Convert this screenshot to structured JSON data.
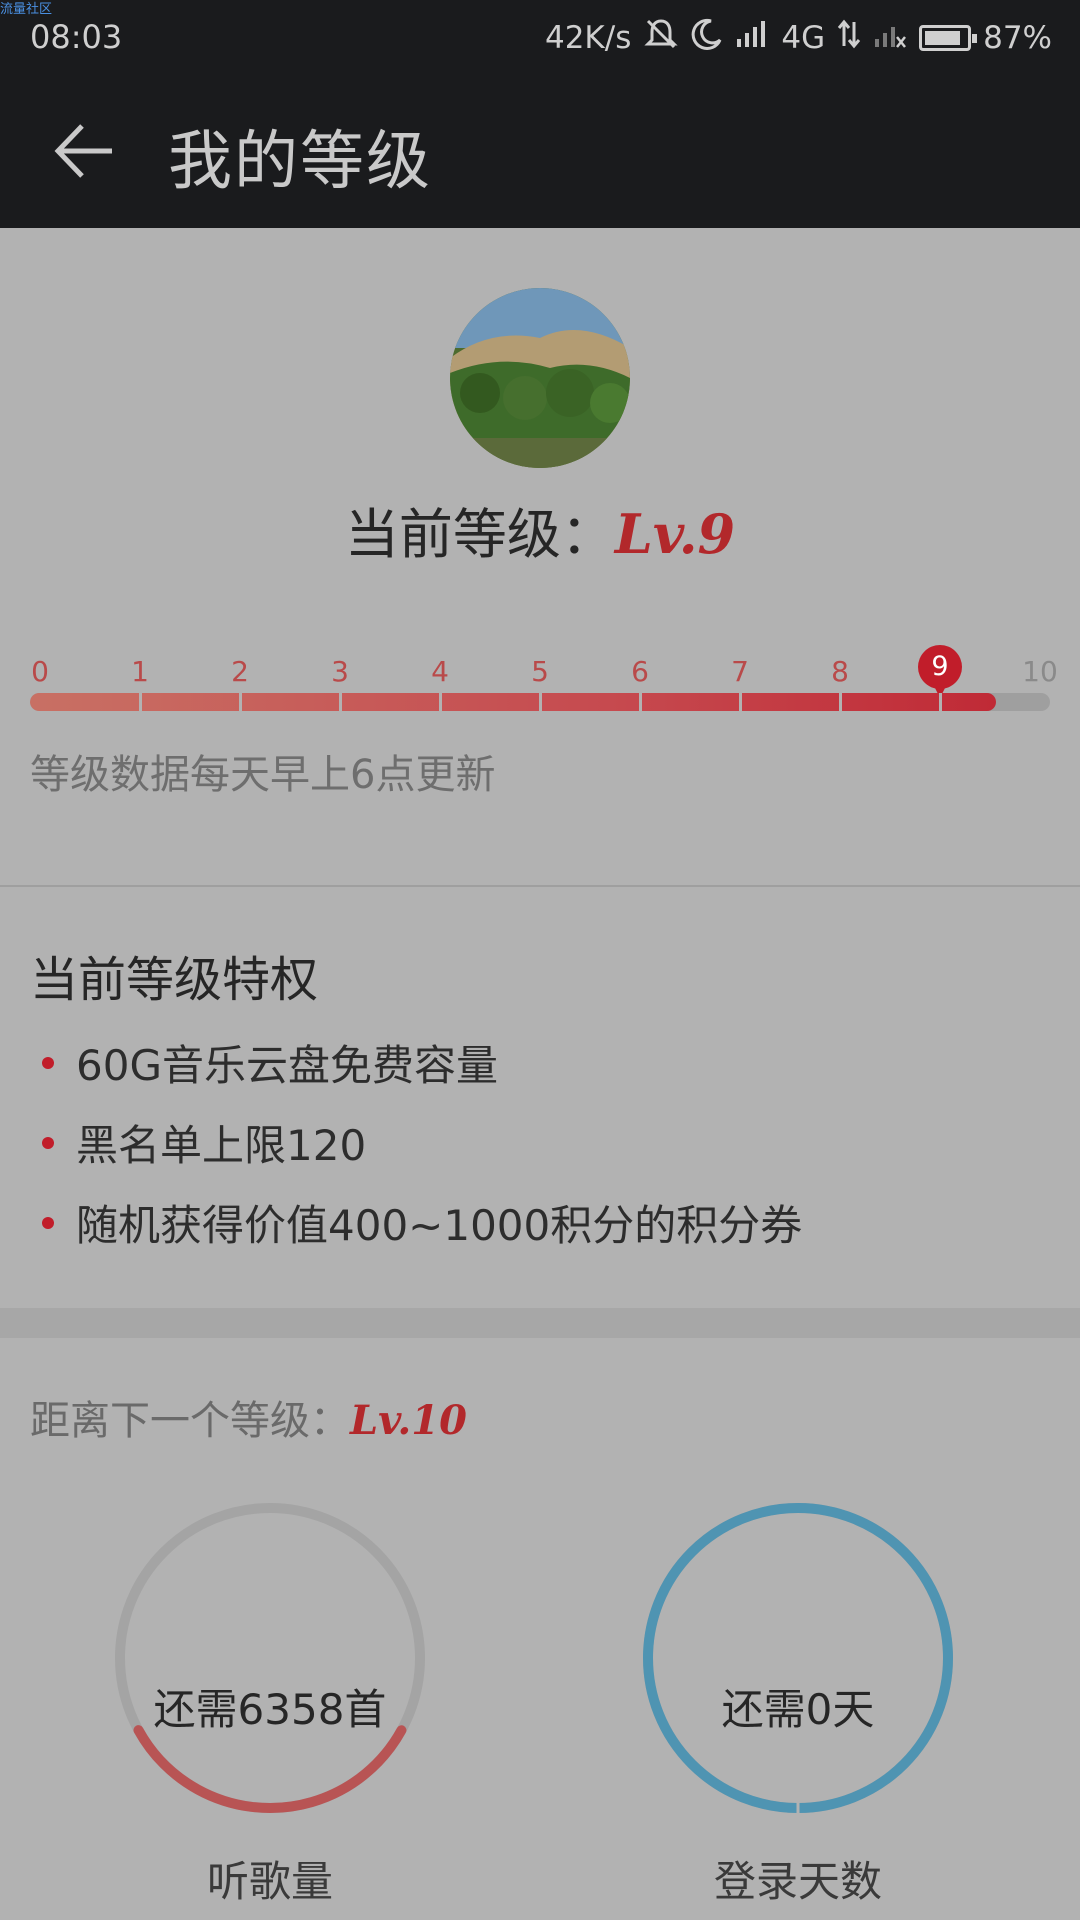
{
  "status_bar": {
    "watermark": "流量社区",
    "time": "08:03",
    "net_speed": "42K/s",
    "network": "4G",
    "battery_pct": "87%",
    "battery_level": 0.87,
    "icons": [
      "mute-icon",
      "moon-icon",
      "signal-icon",
      "data-arrows-icon",
      "no-signal-icon",
      "battery-icon"
    ]
  },
  "header": {
    "title": "我的等级",
    "back_icon": "back-arrow-icon"
  },
  "profile": {
    "current_level_label": "当前等级：",
    "current_level_value": "Lv.9",
    "scale_ticks": [
      "0",
      "1",
      "2",
      "3",
      "4",
      "5",
      "6",
      "7",
      "8",
      "9",
      "10"
    ],
    "current_level_index": 9,
    "progress_fraction": 0.947,
    "update_note": "等级数据每天早上6点更新"
  },
  "privileges": {
    "title": "当前等级特权",
    "items": [
      "60G音乐云盘免费容量",
      "黑名单上限120",
      "随机获得价值400~1000积分的积分券"
    ]
  },
  "next_level": {
    "label": "距离下一个等级：",
    "value": "Lv.10",
    "songs": {
      "text": "还需6358首",
      "label": "听歌量",
      "progress": 0.34,
      "color": "#b85454"
    },
    "days": {
      "text": "还需0天",
      "label": "登录天数",
      "progress": 1.0,
      "color": "#4f94b2"
    }
  },
  "colors": {
    "accent": "#c11d2a",
    "bar_dark": "#1a1b1d",
    "background": "#b2b2b2"
  }
}
